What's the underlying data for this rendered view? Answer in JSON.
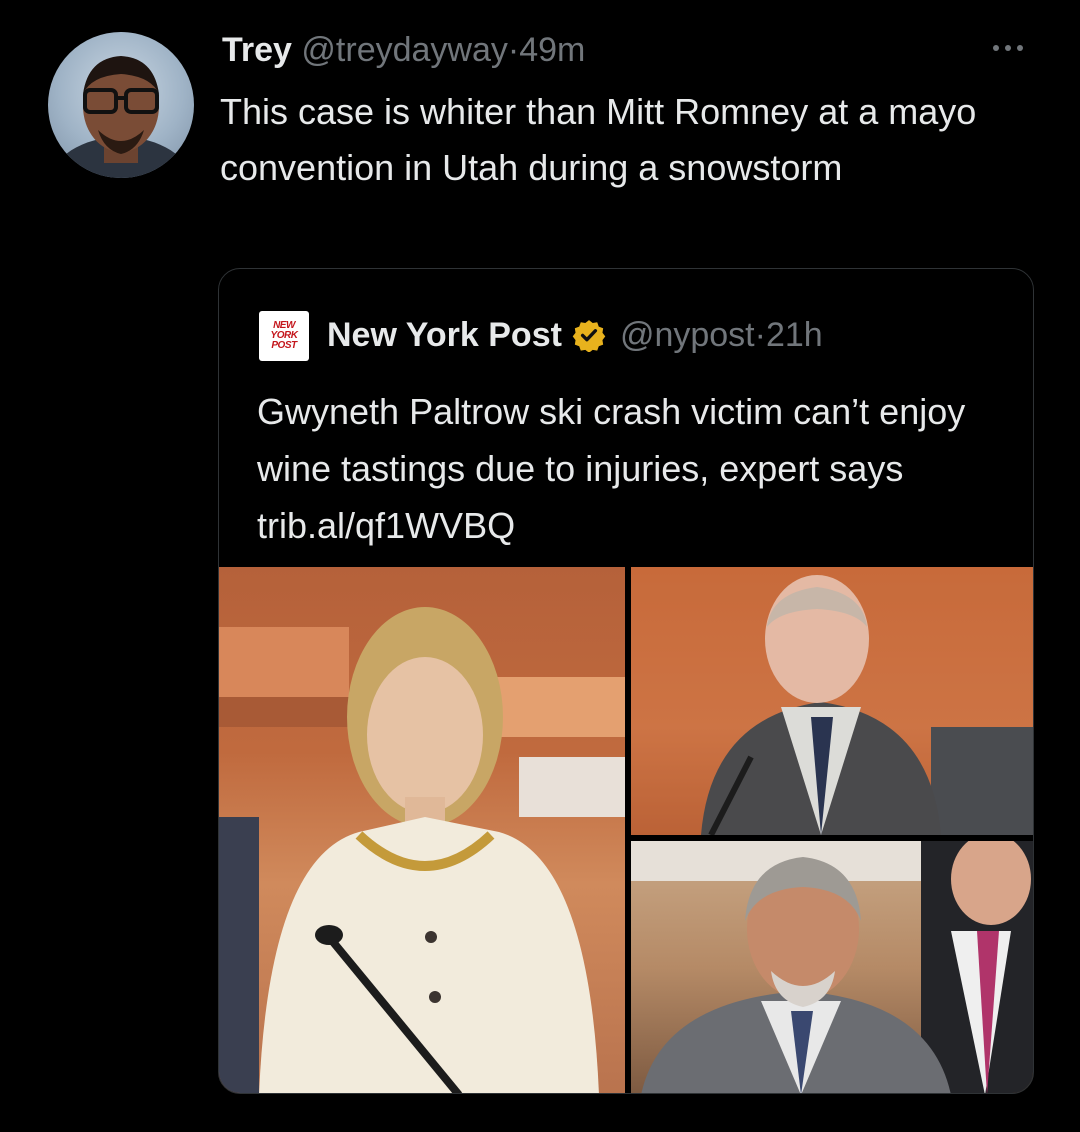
{
  "tweet": {
    "author_name": "Trey",
    "author_handle": "@treydayway",
    "separator": "·",
    "time": "49m",
    "text": "This case is whiter than Mitt Romney at a mayo convention in Utah during a snowstorm",
    "avatar_icon": "profile-avatar",
    "more_icon": "more-dots-icon"
  },
  "quoted_tweet": {
    "logo_text": "NEW YORK POST",
    "author_name": "New York Post",
    "verified_icon": "verified-badge-icon",
    "author_handle": "@nypost",
    "separator": "·",
    "time": "21h",
    "text": "Gwyneth Paltrow ski crash victim can’t enjoy wine tastings due to injuries, expert says trib.al/qf1WVBQ",
    "media": [
      {
        "name": "woman-in-courtroom-photo"
      },
      {
        "name": "older-man-witness-stand-photo"
      },
      {
        "name": "gray-haired-man-courtroom-photo"
      }
    ]
  },
  "colors": {
    "background": "#000000",
    "primary_text": "#e7e9ea",
    "secondary_text": "#71767b",
    "border": "#2f3336",
    "verified_gold": "#e8b21d",
    "nypost_red": "#c4161c"
  }
}
